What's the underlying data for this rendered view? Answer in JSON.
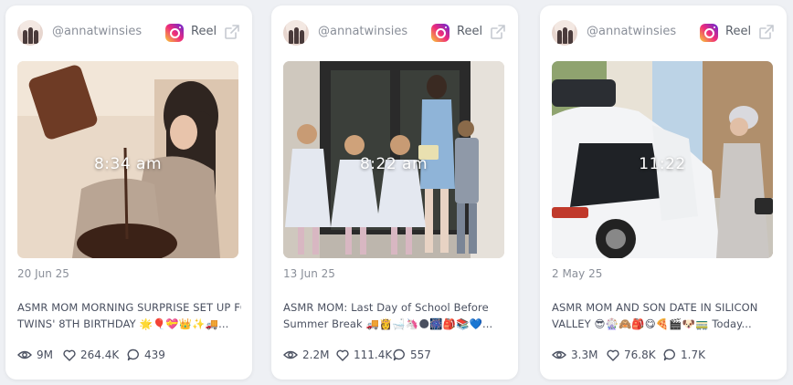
{
  "colors": {
    "page_bg": "#eef0f4",
    "card_bg": "#ffffff",
    "muted_text": "#8a8f99",
    "body_text": "#4a5060"
  },
  "cards": [
    {
      "handle": "@annatwinsies",
      "platform_label": "Reel",
      "thumb_time": "8:34 am",
      "date": "20 Jun 25",
      "caption_line1": "ASMR MOM MORNING SURPRISE SET UP FOR",
      "caption_line2": "TWINS' 8TH BIRTHDAY 🌟🎈💝👑✨🚚...",
      "views": "9M",
      "likes": "264.4K",
      "comments": "439"
    },
    {
      "handle": "@annatwinsies",
      "platform_label": "Reel",
      "thumb_time": "8:22 am",
      "date": "13 Jun 25",
      "caption_line1": "ASMR MOM: Last Day of School Before",
      "caption_line2": "Summer Break 🚚👸🛁🦄🌑🎆🎒📚💙...",
      "views": "2.2M",
      "likes": "111.4K",
      "comments": "557"
    },
    {
      "handle": "@annatwinsies",
      "platform_label": "Reel",
      "thumb_time": "11:22",
      "date": "2 May 25",
      "caption_line1": "ASMR MOM AND SON DATE IN SILICON",
      "caption_line2": "VALLEY 😎🎡🙈🎒😋🍕🎬🐶🚃 Today...",
      "views": "3.3M",
      "likes": "76.8K",
      "comments": "1.7K"
    }
  ]
}
